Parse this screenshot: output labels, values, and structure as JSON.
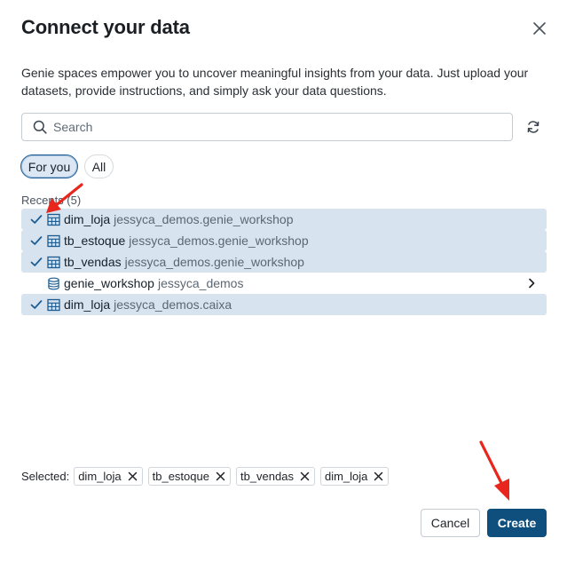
{
  "dialog": {
    "title": "Connect your data",
    "description": "Genie spaces empower you to uncover meaningful insights from your data. Just upload your datasets, provide instructions, and simply ask your data questions."
  },
  "search": {
    "placeholder": "Search",
    "value": ""
  },
  "filters": [
    {
      "label": "For you",
      "active": true
    },
    {
      "label": "All",
      "active": false
    }
  ],
  "recents": {
    "label": "Recents (5)",
    "items": [
      {
        "name": "dim_loja",
        "path": "jessyca_demos.genie_workshop",
        "type": "table",
        "selected": true
      },
      {
        "name": "tb_estoque",
        "path": "jessyca_demos.genie_workshop",
        "type": "table",
        "selected": true
      },
      {
        "name": "tb_vendas",
        "path": "jessyca_demos.genie_workshop",
        "type": "table",
        "selected": true
      },
      {
        "name": "genie_workshop",
        "path": "jessyca_demos",
        "type": "schema",
        "selected": false
      },
      {
        "name": "dim_loja",
        "path": "jessyca_demos.caixa",
        "type": "table",
        "selected": true
      }
    ]
  },
  "selected": {
    "label": "Selected:",
    "chips": [
      "dim_loja",
      "tb_estoque",
      "tb_vendas",
      "dim_loja"
    ]
  },
  "footer": {
    "cancel_label": "Cancel",
    "create_label": "Create"
  },
  "colors": {
    "accent": "#0e4f7d",
    "selected_row": "#d7e3ee",
    "annotation_arrow": "#e8261d"
  },
  "icons": [
    "close-icon",
    "search-icon",
    "refresh-icon",
    "check-icon",
    "table-icon",
    "database-icon",
    "chevron-right-icon",
    "remove-icon"
  ]
}
